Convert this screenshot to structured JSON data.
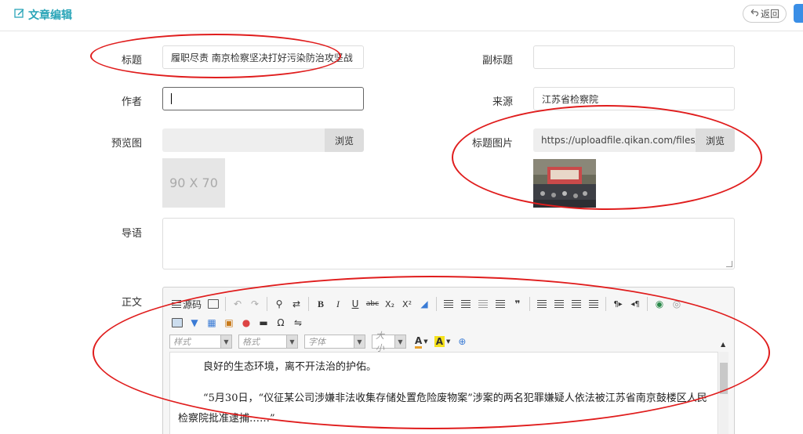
{
  "header": {
    "title": "文章编辑",
    "back_label": "返回"
  },
  "form": {
    "title_label": "标题",
    "title_value": "履职尽责 南京检察坚决打好污染防治攻坚战",
    "subtitle_label": "副标题",
    "subtitle_value": "",
    "author_label": "作者",
    "author_value": "",
    "source_label": "来源",
    "source_value": "江苏省检察院",
    "preview_label": "预览图",
    "preview_path": "",
    "browse_label": "浏览",
    "preview_placeholder": "90 X 70",
    "cover_label": "标题图片",
    "cover_path": "https://uploadfile.qikan.com/files/p",
    "intro_label": "导语",
    "intro_value": "",
    "body_label": "正文"
  },
  "editor": {
    "toolbar1": {
      "source_label": "源码"
    },
    "combos": [
      "样式",
      "格式",
      "字体",
      "大小"
    ],
    "content": {
      "paragraph1": "良好的生态环境，离不开法治的护佑。",
      "paragraph2": "“5月30日，“仪征某公司涉嫌非法收集存储处置危险废物案”涉案的两名犯罪嫌疑人依法被江苏省南京鼓楼区人民检察院批准逮捕……”"
    }
  },
  "colors": {
    "accent": "#2aa5b8",
    "annotation": "#e01d1d"
  }
}
